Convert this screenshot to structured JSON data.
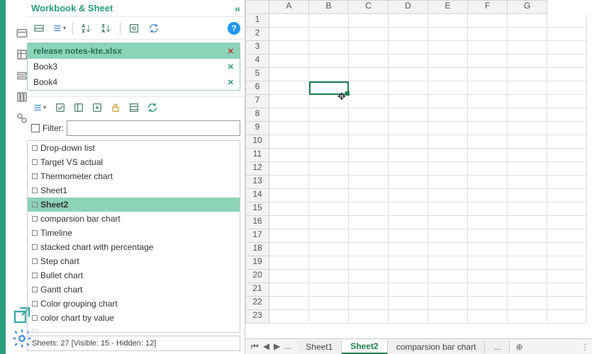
{
  "header": {
    "title": "Workbook & Sheet"
  },
  "workbooks": [
    {
      "name": "release notes-kte.xlsx",
      "active": true
    },
    {
      "name": "Book3",
      "active": false
    },
    {
      "name": "Book4",
      "active": false
    }
  ],
  "filter": {
    "label": "Filter:",
    "value": ""
  },
  "sheets": [
    {
      "name": "Drop-down list",
      "sel": false
    },
    {
      "name": "Target VS actual",
      "sel": false
    },
    {
      "name": "Thermometer chart",
      "sel": false
    },
    {
      "name": "Sheet1",
      "sel": false
    },
    {
      "name": "Sheet2",
      "sel": true
    },
    {
      "name": "comparsion bar chart",
      "sel": false
    },
    {
      "name": "Timeline",
      "sel": false
    },
    {
      "name": "stacked chart with percentage",
      "sel": false
    },
    {
      "name": "Step chart",
      "sel": false
    },
    {
      "name": "Bullet chart",
      "sel": false
    },
    {
      "name": "Gantt chart",
      "sel": false
    },
    {
      "name": "Color grouping chart",
      "sel": false
    },
    {
      "name": "color chart by value",
      "sel": false
    }
  ],
  "status": "Sheets: 27  [Visible: 15 - Hidden: 12]",
  "columns": [
    "A",
    "B",
    "C",
    "D",
    "E",
    "F",
    "G"
  ],
  "rows": [
    1,
    2,
    3,
    4,
    5,
    6,
    7,
    8,
    9,
    10,
    11,
    12,
    13,
    14,
    15,
    16,
    17,
    18,
    19,
    20,
    21,
    22,
    23
  ],
  "active_cell": {
    "col": "B",
    "row": 6
  },
  "tabs": {
    "nav_dots": "...",
    "items": [
      {
        "label": "Sheet1",
        "active": false
      },
      {
        "label": "Sheet2",
        "active": true
      },
      {
        "label": "comparsion bar chart",
        "active": false
      }
    ],
    "more": "...",
    "add": "⊕"
  }
}
